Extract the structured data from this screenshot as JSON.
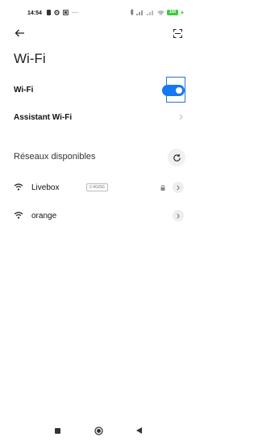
{
  "status_bar": {
    "time": "14:54",
    "more": "···",
    "battery": "100"
  },
  "header": {
    "back_icon": "arrow-left-icon",
    "scan_icon": "qr-scan-icon"
  },
  "page_title": "Wi-Fi",
  "wifi_toggle": {
    "label": "Wi-Fi",
    "enabled": true,
    "accent": "#1678f2"
  },
  "assistant": {
    "label": "Assistant Wi-Fi"
  },
  "available": {
    "label": "Réseaux disponibles",
    "refresh_icon": "refresh-icon"
  },
  "networks": [
    {
      "name": "Livebox",
      "band": "2.4G/5G",
      "locked": true
    },
    {
      "name": "orange",
      "band": "",
      "locked": false
    }
  ],
  "nav": {
    "recent_icon": "square-icon",
    "home_icon": "circle-icon",
    "back_icon": "triangle-back-icon"
  }
}
